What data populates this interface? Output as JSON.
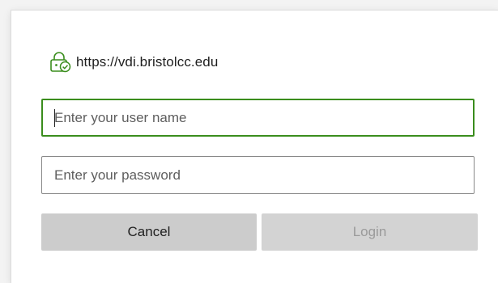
{
  "dialog": {
    "url": "https://vdi.bristolcc.edu",
    "icons": {
      "secure": "lock-check-icon"
    },
    "username": {
      "value": "",
      "placeholder": "Enter your user name"
    },
    "password": {
      "value": "",
      "placeholder": "Enter your password"
    },
    "buttons": {
      "cancel_label": "Cancel",
      "login_label": "Login",
      "login_disabled": true
    },
    "colors": {
      "accent": "#3a8d1d",
      "button_bg": "#cccccc",
      "disabled_text": "#9a9a9a"
    }
  }
}
